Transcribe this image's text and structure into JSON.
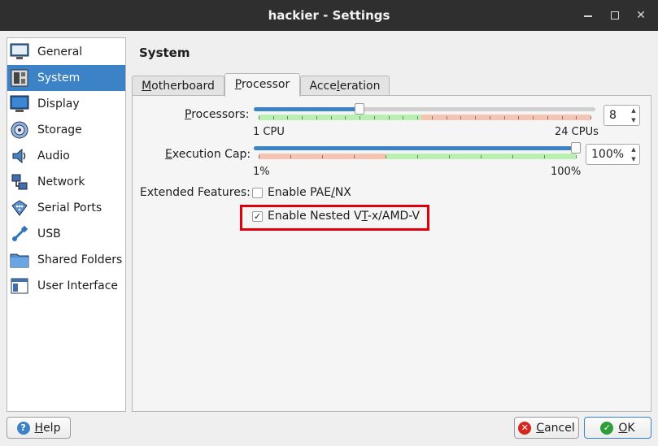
{
  "window": {
    "title": "hackier - Settings",
    "minimize_icon": "minimize-icon",
    "maximize_icon": "maximize-icon",
    "close_icon": "close-icon",
    "close_glyph": "✕"
  },
  "sidebar": {
    "items": [
      {
        "label": "General",
        "icon": "monitor-general-icon"
      },
      {
        "label": "System",
        "icon": "motherboard-icon"
      },
      {
        "label": "Display",
        "icon": "display-icon"
      },
      {
        "label": "Storage",
        "icon": "disk-storage-icon"
      },
      {
        "label": "Audio",
        "icon": "speaker-icon"
      },
      {
        "label": "Network",
        "icon": "network-icon"
      },
      {
        "label": "Serial Ports",
        "icon": "serial-port-icon"
      },
      {
        "label": "USB",
        "icon": "usb-icon"
      },
      {
        "label": "Shared Folders",
        "icon": "folder-icon"
      },
      {
        "label": "User Interface",
        "icon": "window-ui-icon"
      }
    ],
    "active_index": 1
  },
  "main": {
    "title": "System",
    "tabs": [
      {
        "label": "Motherboard",
        "active": false
      },
      {
        "label": "Processor",
        "active": true
      },
      {
        "label": "Acceleration",
        "active": false
      }
    ],
    "processor": {
      "processors_label": "Processors:",
      "processors_value": "8",
      "processors_min_label": "1 CPU",
      "processors_max_label": "24 CPUs",
      "processors_min": 1,
      "processors_max": 24,
      "processors_current": 8,
      "exec_cap_label": "Execution Cap:",
      "exec_cap_value": "100%",
      "exec_cap_min_label": "1%",
      "exec_cap_max_label": "100%",
      "exec_cap_current_percent": 100,
      "extended_features_label": "Extended Features:",
      "pae_label": "Enable PAE/NX",
      "pae_checked": false,
      "nested_label": "Enable Nested VT-x/AMD-V",
      "nested_checked": true,
      "check_glyph": "✓",
      "spin_up": "▲",
      "spin_down": "▼"
    }
  },
  "footer": {
    "help_label": "Help",
    "cancel_label": "Cancel",
    "ok_label": "OK",
    "help_icon": "help-icon",
    "cancel_icon": "cancel-icon",
    "ok_icon": "ok-checkmark-icon",
    "help_glyph": "?",
    "cancel_glyph": "✕",
    "ok_glyph": "✓"
  },
  "colors": {
    "accent": "#3b83c6",
    "titlebar": "#2f2f2f",
    "highlight_border": "#e0000b",
    "zone_green": "#b9efb1",
    "zone_red": "#f5c4b2"
  }
}
